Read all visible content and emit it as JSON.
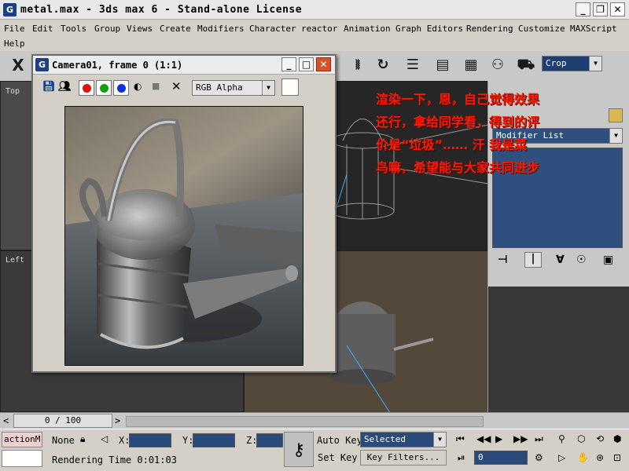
{
  "window": {
    "title": "metal.max - 3ds max 6 - Stand-alone License",
    "app_icon": "3ds-max-logo-icon",
    "controls": {
      "minimize": "_",
      "restore": "❐",
      "close": "✕"
    }
  },
  "menu": {
    "items": [
      "File",
      "Edit",
      "Tools",
      "Group",
      "Views",
      "Create",
      "Modifiers",
      "Character",
      "reactor",
      "Animation",
      "Graph Editors",
      "Rendering",
      "Customize",
      "MAXScript",
      "Help"
    ]
  },
  "toolbar": {
    "x_label": "X",
    "crop_select": "Crop"
  },
  "viewports": {
    "top_label": "Top",
    "left_label": "Left"
  },
  "render_window": {
    "title": "Camera01, frame 0 (1:1)",
    "controls": {
      "minimize": "_",
      "restore": "□",
      "close": "✕"
    },
    "channel_select": "RGB Alpha",
    "colors": {
      "red": "#e01010",
      "green": "#10a010",
      "blue": "#1030e0"
    }
  },
  "annotation": {
    "lines": [
      "渲染一下，恩，自己觉得效果",
      "还行，拿给同学看，得到的评",
      "价是“垃圾”……  汗 我是菜",
      "鸟嘛，希望能与大家共同进步"
    ],
    "color": "#ff1a00"
  },
  "command_panel": {
    "modifier_list": "Modifier List"
  },
  "timeline": {
    "frame_counter": "0 / 100",
    "prev_arrow": "<",
    "next_arrow": ">"
  },
  "status": {
    "script_listener": "actionM",
    "selection_lock": "None",
    "x_label": "X:",
    "y_label": "Y:",
    "z_label": "Z:",
    "rendering_time": "Rendering Time  0:01:03",
    "auto_key": "Auto Key",
    "set_key": "Set Key",
    "selected_select": "Selected",
    "key_filters": "Key Filters...",
    "frame_input": "0"
  }
}
